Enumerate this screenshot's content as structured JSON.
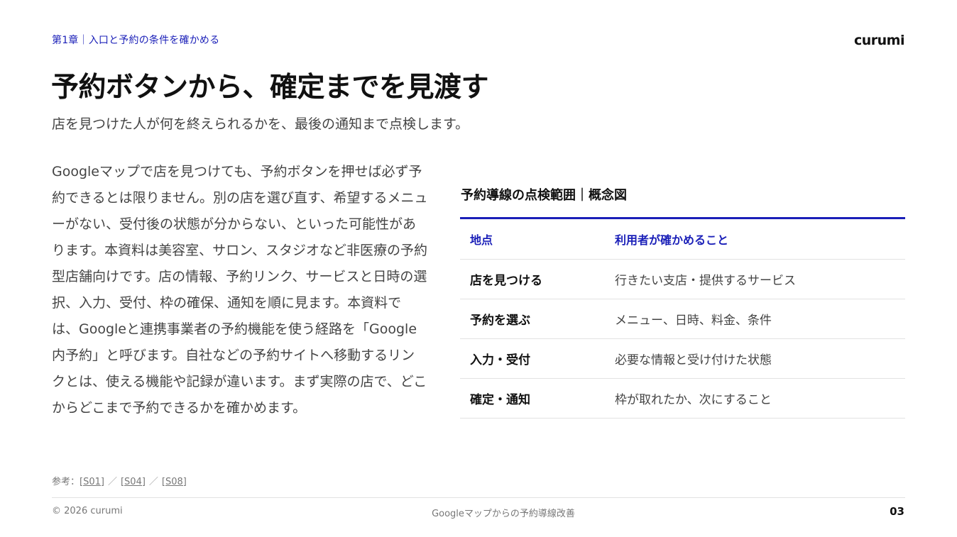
{
  "header": {
    "chapter": "第1章｜入口と予約の条件を確かめる",
    "brand": "curumi"
  },
  "title": "予約ボタンから、確定までを見渡す",
  "subtitle": "店を見つけた人が何を終えられるかを、最後の通知まで点検します。",
  "body": "Googleマップで店を見つけても、予約ボタンを押せば必ず予約できるとは限りません。別の店を選び直す、希望するメニューがない、受付後の状態が分からない、といった可能性があります。本資料は美容室、サロン、スタジオなど非医療の予約型店舗向けです。店の情報、予約リンク、サービスと日時の選択、入力、受付、枠の確保、通知を順に見ます。本資料では、Googleと連携事業者の予約機能を使う経路を「Google内予約」と呼びます。自社などの予約サイトへ移動するリンクとは、使える機能や記録が違います。まず実際の店で、どこからどこまで予約できるかを確かめます。",
  "table": {
    "title": "予約導線の点検範囲｜概念図",
    "headers": [
      "地点",
      "利用者が確かめること"
    ],
    "rows": [
      [
        "店を見つける",
        "行きたい支店・提供するサービス"
      ],
      [
        "予約を選ぶ",
        "メニュー、日時、料金、条件"
      ],
      [
        "入力・受付",
        "必要な情報と受け付けた状態"
      ],
      [
        "確定・通知",
        "枠が取れたか、次にすること"
      ]
    ]
  },
  "references": {
    "prefix": "参考：",
    "items": [
      "[S01]",
      "[S04]",
      "[S08]"
    ],
    "separator": "／"
  },
  "footer": {
    "copyright": "© 2026 curumi",
    "center": "Googleマップからの予約導線改善",
    "page": "03"
  }
}
